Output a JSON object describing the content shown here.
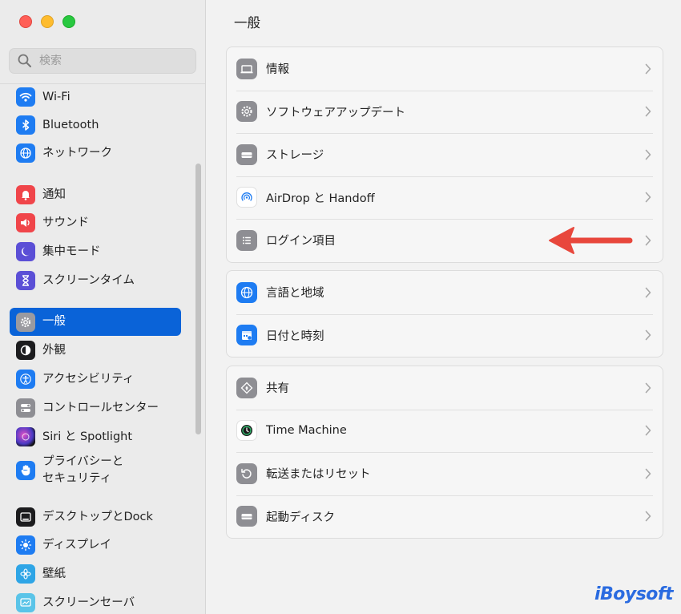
{
  "search": {
    "placeholder": "検索"
  },
  "sidebar": {
    "items": [
      {
        "label": "Wi-Fi"
      },
      {
        "label": "Bluetooth"
      },
      {
        "label": "ネットワーク"
      },
      {
        "label": "通知"
      },
      {
        "label": "サウンド"
      },
      {
        "label": "集中モード"
      },
      {
        "label": "スクリーンタイム"
      },
      {
        "label": "一般"
      },
      {
        "label": "外観"
      },
      {
        "label": "アクセシビリティ"
      },
      {
        "label": "コントロールセンター"
      },
      {
        "label": "Siri と Spotlight"
      },
      {
        "label_line1": "プライバシーと",
        "label_line2": "セキュリティ"
      },
      {
        "label": "デスクトップとDock"
      },
      {
        "label": "ディスプレイ"
      },
      {
        "label": "壁紙"
      },
      {
        "label": "スクリーンセーバ"
      }
    ],
    "selected": "一般"
  },
  "main": {
    "title": "一般",
    "groups": [
      {
        "rows": [
          {
            "label": "情報"
          },
          {
            "label": "ソフトウェアアップデート"
          },
          {
            "label": "ストレージ"
          },
          {
            "label": "AirDrop と Handoff"
          },
          {
            "label": "ログイン項目"
          }
        ]
      },
      {
        "rows": [
          {
            "label": "言語と地域"
          },
          {
            "label": "日付と時刻"
          }
        ]
      },
      {
        "rows": [
          {
            "label": "共有"
          },
          {
            "label": "Time Machine"
          },
          {
            "label": "転送またはリセット"
          },
          {
            "label": "起動ディスク"
          }
        ]
      }
    ]
  },
  "watermark": "iBoysoft",
  "colors": {
    "accent": "#0a63d8",
    "annotation_arrow": "#e8473c"
  },
  "icons": {
    "sidebar": [
      "wifi-icon",
      "bluetooth-icon",
      "globe-icon",
      "bell-icon",
      "speaker-icon",
      "moon-icon",
      "hourglass-icon",
      "gear-icon",
      "appearance-icon",
      "accessibility-icon",
      "switches-icon",
      "siri-icon",
      "hand-icon",
      "dock-icon",
      "sun-icon",
      "flower-icon",
      "screensaver-icon"
    ],
    "rows": [
      "macbook-icon",
      "gear-refresh-icon",
      "drive-icon",
      "airdrop-icon",
      "list-icon",
      "globe-icon",
      "calendar-icon",
      "share-icon",
      "time-machine-icon",
      "reset-icon",
      "disk-icon"
    ]
  }
}
